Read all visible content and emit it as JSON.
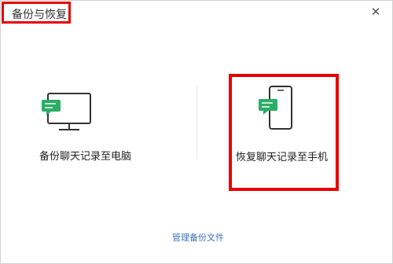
{
  "window": {
    "title": "备份与恢复"
  },
  "options": {
    "backup_label": "备份聊天记录至电脑",
    "restore_label": "恢复聊天记录至手机"
  },
  "footer": {
    "manage_link": "管理备份文件"
  },
  "icons": {
    "close": "close-icon",
    "computer": "computer-chat-icon",
    "phone": "phone-chat-icon"
  },
  "colors": {
    "highlight": "#e60000",
    "link": "#3f6fb5",
    "chat_bubble": "#2aae67"
  }
}
